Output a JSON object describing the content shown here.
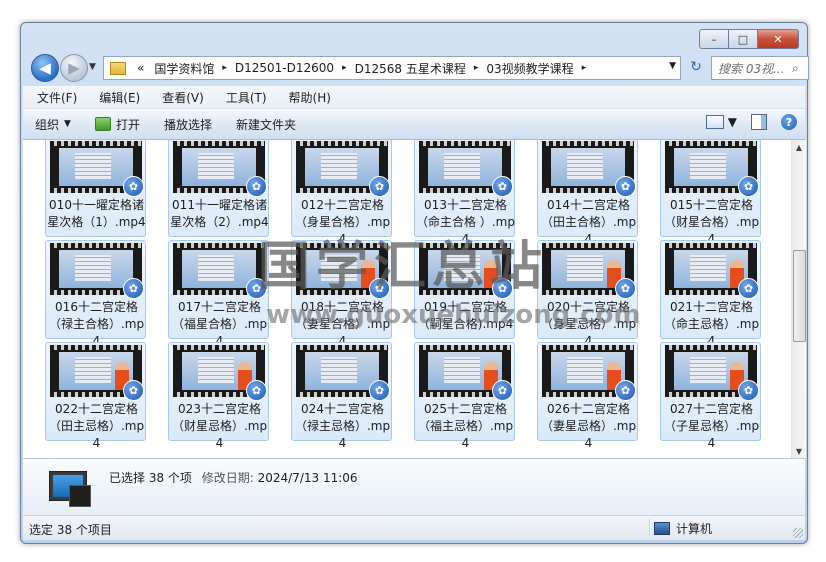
{
  "window": {
    "caption": {
      "min": "–",
      "max": "□",
      "close": "✕"
    }
  },
  "nav": {
    "back": "◀",
    "forward": "▶",
    "history_dropdown": "▼",
    "overflow": "«",
    "breadcrumbs": [
      "国学资料馆",
      "D12501-D12600",
      "D12568 五星术课程",
      "03视频教学课程"
    ],
    "separator": "▸",
    "address_dropdown": "▼",
    "refresh": "↻",
    "search_placeholder": "搜索 03视...",
    "search_icon": "⌕"
  },
  "menubar": {
    "items": [
      "文件(F)",
      "编辑(E)",
      "查看(V)",
      "工具(T)",
      "帮助(H)"
    ]
  },
  "toolbar": {
    "organize": "组织",
    "organize_dd": "▼",
    "open": "打开",
    "play_selection": "播放选择",
    "new_folder": "新建文件夹",
    "views_dd": "▼",
    "help": "?"
  },
  "files": [
    {
      "name": "010十一曜定格诸星次格（1）.mp4",
      "presenter": false
    },
    {
      "name": "011十一曜定格诸星次格（2）.mp4",
      "presenter": false
    },
    {
      "name": "012十二宫定格（身星合格）.mp4",
      "presenter": false
    },
    {
      "name": "013十二宫定格（命主合格 ）.mp4",
      "presenter": false
    },
    {
      "name": "014十二宫定格（田主合格）.mp4",
      "presenter": false
    },
    {
      "name": "015十二宫定格（财星合格）.mp4",
      "presenter": false
    },
    {
      "name": "016十二宫定格（禄主合格）.mp4",
      "presenter": false
    },
    {
      "name": "017十二宫定格（福星合格）.mp4",
      "presenter": false
    },
    {
      "name": "018十二宫定格（妻星合格）.mp4",
      "presenter": true
    },
    {
      "name": "019十二宫定格（嗣星合格).mp4",
      "presenter": true
    },
    {
      "name": "020十二宫定格（身星忌格）.mp4",
      "presenter": true
    },
    {
      "name": "021十二宫定格（命主忌格）.mp4",
      "presenter": true
    },
    {
      "name": "022十二宫定格（田主忌格）.mp4",
      "presenter": true
    },
    {
      "name": "023十二宫定格（财星忌格）.mp4",
      "presenter": true
    },
    {
      "name": "024十二宫定格（禄主忌格）.mp4",
      "presenter": false
    },
    {
      "name": "025十二宫定格（福主忌格）.mp4",
      "presenter": true
    },
    {
      "name": "026十二宫定格（妻星忌格）.mp4",
      "presenter": true
    },
    {
      "name": "027十二宫定格（子星忌格）.mp4",
      "presenter": true
    }
  ],
  "badge_glyph": "✿",
  "details": {
    "selected": "已选择 38 个项",
    "modified_label": "修改日期:",
    "modified_value": "2024/7/13 11:06"
  },
  "statusbar": {
    "left": "选定 38 个项目",
    "right": "计算机"
  },
  "watermark": {
    "title": "国学汇总站",
    "url": "www.guoxuehuizong.com"
  }
}
